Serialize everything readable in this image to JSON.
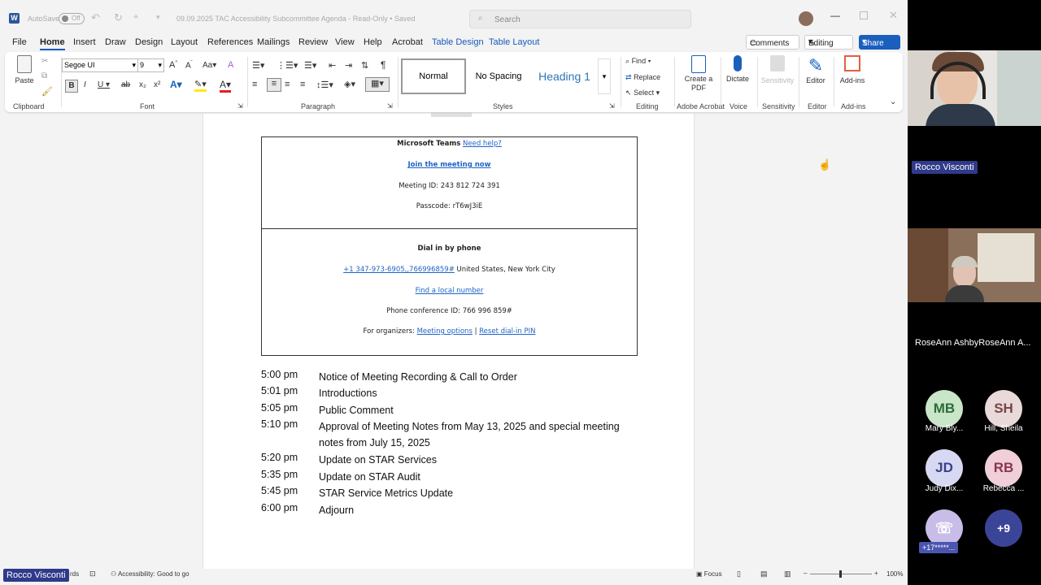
{
  "titlebar": {
    "autosave": "AutoSave",
    "autosave_state": "Off",
    "doc_title": "09.09.2025 TAC Accessibility Subcommittee Agenda  -  Read-Only  •  Saved",
    "search_placeholder": "Search"
  },
  "menu": {
    "tabs": [
      "File",
      "Home",
      "Insert",
      "Draw",
      "Design",
      "Layout",
      "References",
      "Mailings",
      "Review",
      "View",
      "Help",
      "Acrobat",
      "Table Design",
      "Table Layout"
    ],
    "comments": "Comments",
    "editing": "Editing",
    "share": "Share"
  },
  "ribbon": {
    "paste": "Paste",
    "clipboard": "Clipboard",
    "font_name": "Segoe UI",
    "font_size": "9",
    "font": "Font",
    "paragraph": "Paragraph",
    "styles": [
      "Normal",
      "No Spacing",
      "Heading 1"
    ],
    "styles_label": "Styles",
    "find": "Find",
    "replace": "Replace",
    "select": "Select",
    "editing": "Editing",
    "create_pdf": "Create a PDF",
    "adobe": "Adobe Acrobat",
    "dictate": "Dictate",
    "voice": "Voice",
    "sensitivity": "Sensitivity",
    "editor": "Editor",
    "addins": "Add-ins"
  },
  "meeting": {
    "teams": "Microsoft Teams",
    "need_help": "Need help?",
    "join": "Join the meeting now",
    "meeting_id": "Meeting ID: 243 812 724 391",
    "passcode": "Passcode: rT6wJ3iE",
    "dial_in": "Dial in by phone",
    "phone_link": "+1 347-973-6905,,766996859#",
    "phone_loc": " United States, New York City",
    "find_local": "Find a local number",
    "conf_id": "Phone conference ID: 766 996 859#",
    "organizers": "For organizers: ",
    "meeting_options": "Meeting options",
    "pipe": " | ",
    "reset_pin": "Reset dial-in PIN"
  },
  "agenda": [
    {
      "time": "5:00 pm",
      "item": "Notice of Meeting Recording & Call to Order"
    },
    {
      "time": "5:01 pm",
      "item": "Introductions"
    },
    {
      "time": "5:05 pm",
      "item": "Public Comment"
    },
    {
      "time": "5:10 pm",
      "item": "Approval of Meeting Notes from May 13, 2025 and special meeting notes from July 15, 2025"
    },
    {
      "time": "5:20 pm",
      "item": "Update on STAR Services"
    },
    {
      "time": "5:35 pm",
      "item": "Update on STAR Audit"
    },
    {
      "time": "5:45 pm",
      "item": "STAR Service Metrics Update"
    },
    {
      "time": "6:00 pm",
      "item": "Adjourn"
    }
  ],
  "status": {
    "words": "rds",
    "accessibility": "Accessibility: Good to go",
    "focus": "Focus",
    "zoom": "100%"
  },
  "participants": {
    "speaker": "Rocco Visconti",
    "video2": "RoseAnn AshbyRoseAnn A...",
    "overlay_name": "Rocco Visconti",
    "avatars": [
      {
        "initials": "MB",
        "name": "Mary Bly...",
        "bg": "#c9e6c9"
      },
      {
        "initials": "SH",
        "name": "Hill, Sheila",
        "bg": "#ead9d9"
      },
      {
        "initials": "JD",
        "name": "Judy Dix...",
        "bg": "#d7d9f3"
      },
      {
        "initials": "RB",
        "name": "Rebecca ...",
        "bg": "#f0cfd8"
      }
    ],
    "phone_user": "+17*****...",
    "more": "+9"
  }
}
